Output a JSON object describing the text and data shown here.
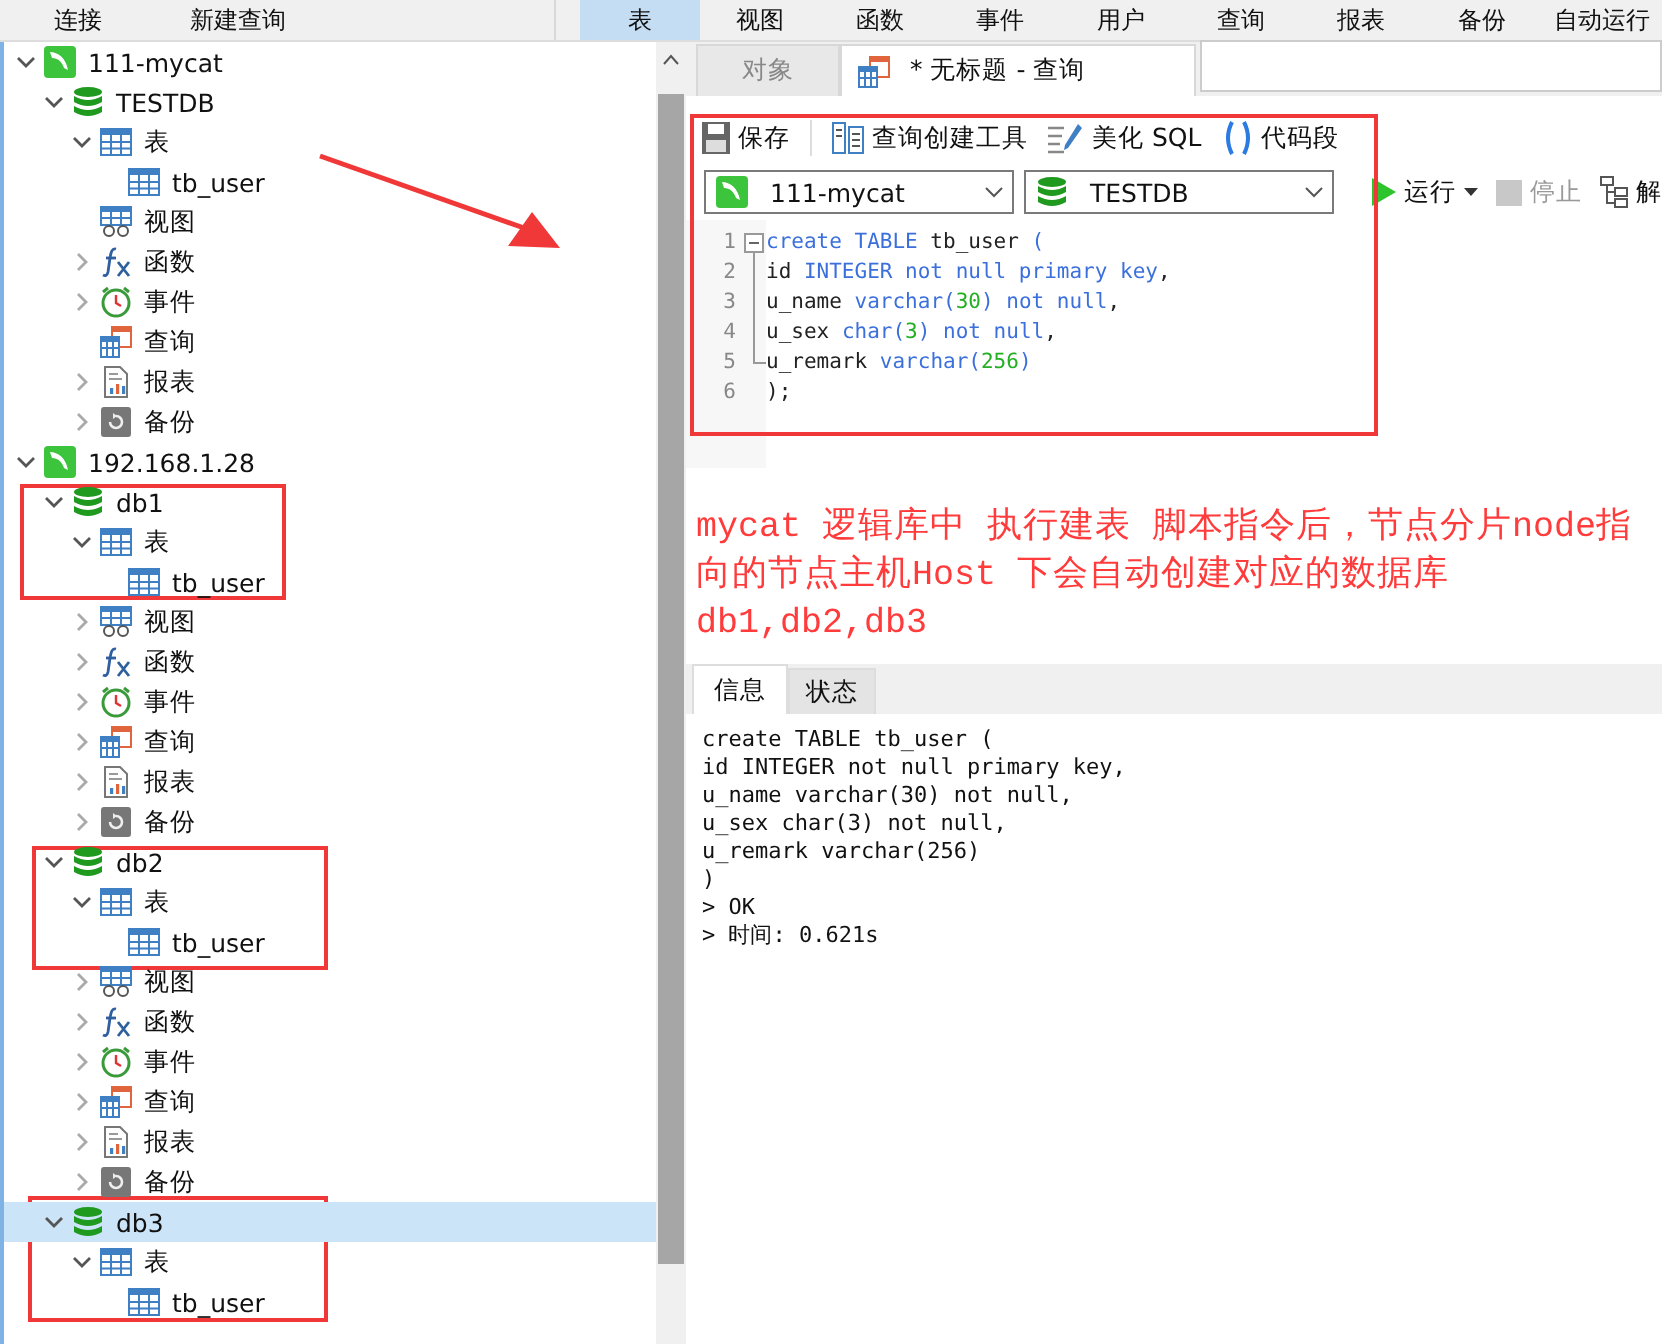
{
  "ribbon": {
    "left": [
      {
        "label": "连接"
      },
      {
        "label": "新建查询"
      }
    ],
    "items": [
      {
        "label": "表",
        "selected": true
      },
      {
        "label": "视图",
        "selected": false
      },
      {
        "label": "函数",
        "selected": false
      },
      {
        "label": "事件",
        "selected": false
      },
      {
        "label": "用户",
        "selected": false
      },
      {
        "label": "查询",
        "selected": false
      },
      {
        "label": "报表",
        "selected": false
      },
      {
        "label": "备份",
        "selected": false
      },
      {
        "label": "自动运行",
        "selected": false
      }
    ]
  },
  "tree": [
    {
      "kind": "connection",
      "label": "111-mycat",
      "expanded": true,
      "selected": false,
      "children": [
        {
          "kind": "database",
          "label": "TESTDB",
          "expanded": true,
          "selected": false,
          "children": [
            {
              "kind": "tables",
              "label": "表",
              "expanded": true,
              "selected": false,
              "children": [
                {
                  "kind": "table",
                  "label": "tb_user",
                  "selected": false
                }
              ]
            },
            {
              "kind": "views",
              "label": "视图",
              "selected": false
            },
            {
              "kind": "functions",
              "label": "函数",
              "expanded": false,
              "selected": false
            },
            {
              "kind": "events",
              "label": "事件",
              "expanded": false,
              "selected": false
            },
            {
              "kind": "queries",
              "label": "查询",
              "selected": false
            },
            {
              "kind": "reports",
              "label": "报表",
              "expanded": false,
              "selected": false
            },
            {
              "kind": "backups",
              "label": "备份",
              "expanded": false,
              "selected": false
            }
          ]
        }
      ]
    },
    {
      "kind": "connection",
      "label": "192.168.1.28",
      "expanded": true,
      "selected": false,
      "children": [
        {
          "kind": "database",
          "label": "db1",
          "expanded": true,
          "selected": false,
          "children": [
            {
              "kind": "tables",
              "label": "表",
              "expanded": true,
              "selected": false,
              "children": [
                {
                  "kind": "table",
                  "label": "tb_user",
                  "selected": false
                }
              ]
            },
            {
              "kind": "views",
              "label": "视图",
              "expanded": false,
              "selected": false
            },
            {
              "kind": "functions",
              "label": "函数",
              "expanded": false,
              "selected": false
            },
            {
              "kind": "events",
              "label": "事件",
              "expanded": false,
              "selected": false
            },
            {
              "kind": "queries",
              "label": "查询",
              "expanded": false,
              "selected": false
            },
            {
              "kind": "reports",
              "label": "报表",
              "expanded": false,
              "selected": false
            },
            {
              "kind": "backups",
              "label": "备份",
              "expanded": false,
              "selected": false
            }
          ]
        },
        {
          "kind": "database",
          "label": "db2",
          "expanded": true,
          "selected": false,
          "children": [
            {
              "kind": "tables",
              "label": "表",
              "expanded": true,
              "selected": false,
              "children": [
                {
                  "kind": "table",
                  "label": "tb_user",
                  "selected": false
                }
              ]
            },
            {
              "kind": "views",
              "label": "视图",
              "expanded": false,
              "selected": false
            },
            {
              "kind": "functions",
              "label": "函数",
              "expanded": false,
              "selected": false
            },
            {
              "kind": "events",
              "label": "事件",
              "expanded": false,
              "selected": false
            },
            {
              "kind": "queries",
              "label": "查询",
              "expanded": false,
              "selected": false
            },
            {
              "kind": "reports",
              "label": "报表",
              "expanded": false,
              "selected": false
            },
            {
              "kind": "backups",
              "label": "备份",
              "expanded": false,
              "selected": false
            }
          ]
        },
        {
          "kind": "database",
          "label": "db3",
          "expanded": true,
          "selected": true,
          "children": [
            {
              "kind": "tables",
              "label": "表",
              "expanded": true,
              "selected": false,
              "children": [
                {
                  "kind": "table",
                  "label": "tb_user",
                  "selected": false
                }
              ]
            }
          ]
        }
      ]
    }
  ],
  "editor_tabs": [
    {
      "label": "对象",
      "kind": "plain",
      "selected": false
    },
    {
      "label": "* 无标题 - 查询",
      "kind": "query",
      "selected": true
    }
  ],
  "toolbar": [
    {
      "kind": "save",
      "label": "保存"
    },
    {
      "kind": "builder",
      "label": "查询创建工具"
    },
    {
      "kind": "beautify",
      "label": "美化 SQL"
    },
    {
      "kind": "snippet",
      "label": "代码段"
    }
  ],
  "connection_select": {
    "value": "111-mycat"
  },
  "database_select": {
    "value": "TESTDB"
  },
  "run_controls": [
    {
      "kind": "run",
      "label": "运行",
      "disabled": false
    },
    {
      "kind": "stop",
      "label": "停止",
      "disabled": true
    },
    {
      "kind": "explain",
      "label": "解",
      "disabled": false
    }
  ],
  "code_lines": [
    {
      "number": "1",
      "tokens": [
        {
          "kind": "keyword",
          "text": "create TABLE"
        },
        {
          "kind": "plain",
          "text": " tb_user "
        },
        {
          "kind": "keyword",
          "text": "("
        }
      ]
    },
    {
      "number": "2",
      "tokens": [
        {
          "kind": "plain",
          "text": "id "
        },
        {
          "kind": "keyword",
          "text": "INTEGER not null primary key"
        },
        {
          "kind": "plain",
          "text": ","
        }
      ]
    },
    {
      "number": "3",
      "tokens": [
        {
          "kind": "plain",
          "text": "u_name "
        },
        {
          "kind": "keyword",
          "text": "varchar("
        },
        {
          "kind": "number",
          "text": "30"
        },
        {
          "kind": "keyword",
          "text": ") not null"
        },
        {
          "kind": "plain",
          "text": ","
        }
      ]
    },
    {
      "number": "4",
      "tokens": [
        {
          "kind": "plain",
          "text": "u_sex "
        },
        {
          "kind": "keyword",
          "text": "char("
        },
        {
          "kind": "number",
          "text": "3"
        },
        {
          "kind": "keyword",
          "text": ") not null"
        },
        {
          "kind": "plain",
          "text": ","
        }
      ]
    },
    {
      "number": "5",
      "tokens": [
        {
          "kind": "plain",
          "text": "u_remark "
        },
        {
          "kind": "keyword",
          "text": "varchar("
        },
        {
          "kind": "number",
          "text": "256"
        },
        {
          "kind": "keyword",
          "text": ")"
        }
      ]
    },
    {
      "number": "6",
      "tokens": [
        {
          "kind": "plain",
          "text": ");"
        }
      ]
    }
  ],
  "note": [
    "mycat 逻辑库中 执行建表 脚本指令后，节点分片node指向的节点主机Host 下会自动创建对应的数据库",
    "db1,db2,db3"
  ],
  "result_tabs": [
    {
      "label": "信息",
      "selected": true
    },
    {
      "label": "状态",
      "selected": false
    }
  ],
  "messages": [
    "create TABLE tb_user (",
    "id INTEGER not null primary key,",
    "u_name varchar(30) not null,",
    "u_sex char(3) not null,",
    "u_remark varchar(256)",
    ")",
    "> OK",
    "> 时间: 0.621s"
  ]
}
